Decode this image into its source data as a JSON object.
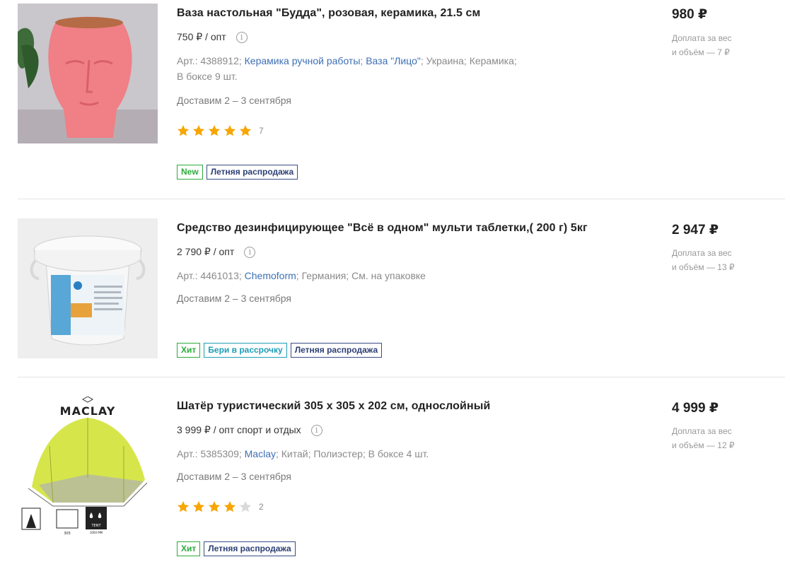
{
  "products": [
    {
      "title": "Ваза настольная \"Будда\", розовая, керамика, 21.5 см",
      "opt_price": "750 ₽ / опт",
      "article": "Арт.: 4388912;",
      "links": [
        "Керамика ручной работы",
        "Ваза \"Лицо\""
      ],
      "attrs_tail": "Украина; Керамика;",
      "box": "В боксе 9 шт.",
      "delivery": "Доставим 2 – 3 сентября",
      "rating": 5,
      "rating_count": "7",
      "badges": [
        {
          "label": "New",
          "style": "green"
        },
        {
          "label": "Летняя распродажа",
          "style": "navy"
        }
      ],
      "price": "980 ₽",
      "surcharge_line1": "Доплата за вес",
      "surcharge_line2": "и объём — 7 ₽"
    },
    {
      "title": "Средство дезинфицирующее \"Всё в одном\" мульти таблетки,( 200 г) 5кг",
      "opt_price": "2 790 ₽ / опт",
      "article": "Арт.: 4461013;",
      "links": [
        "Chemoform"
      ],
      "attrs_tail": "Германия; См. на упаковке",
      "delivery": "Доставим 2 – 3 сентября",
      "badges": [
        {
          "label": "Хит",
          "style": "green"
        },
        {
          "label": "Бери в рассрочку",
          "style": "teal"
        },
        {
          "label": "Летняя распродажа",
          "style": "navy"
        }
      ],
      "price": "2 947 ₽",
      "surcharge_line1": "Доплата за вес",
      "surcharge_line2": "и объём — 13 ₽"
    },
    {
      "title": "Шатёр туристический 305 х 305 х 202 см, однослойный",
      "opt_price": "3 999 ₽ / опт спорт и отдых",
      "article": "Арт.: 5385309;",
      "links": [
        "Maclay"
      ],
      "attrs_tail": "Китай; Полиэстер; В боксе 4 шт.",
      "delivery": "Доставим 2 – 3 сентября",
      "rating": 4,
      "rating_count": "2",
      "badges": [
        {
          "label": "Хит",
          "style": "green"
        },
        {
          "label": "Летняя распродажа",
          "style": "navy"
        }
      ],
      "price": "4 999 ₽",
      "surcharge_line1": "Доплата за вес",
      "surcharge_line2": "и объём — 12 ₽",
      "image_brand": "MACLAY",
      "image_dims": "305",
      "image_tent_label": "TENT",
      "image_water": "1000 MM"
    }
  ],
  "colors": {
    "link": "#3d6fb5",
    "star": "#f7a600",
    "badge_green": "#2bab3a",
    "badge_teal": "#1d9db5",
    "badge_navy": "#2c3f74"
  }
}
